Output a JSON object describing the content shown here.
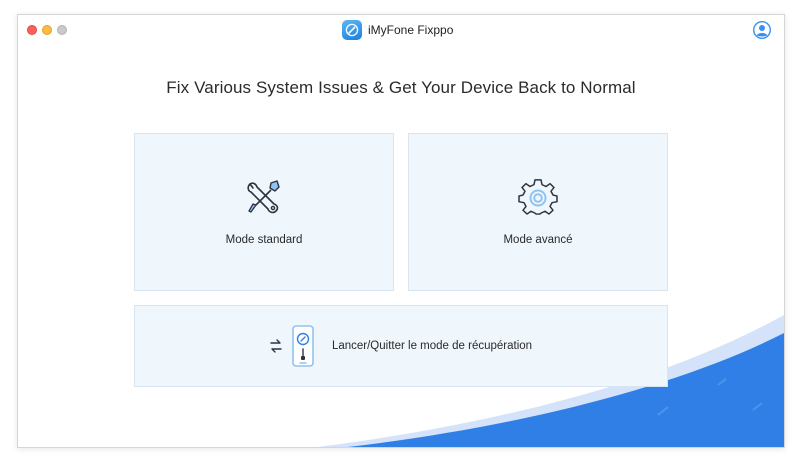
{
  "window": {
    "title": "iMyFone Fixppo"
  },
  "main": {
    "headline": "Fix Various System Issues & Get Your Device Back to Normal",
    "modes": [
      {
        "label": "Mode standard",
        "icon": "tools-icon"
      },
      {
        "label": "Mode avancé",
        "icon": "gear-icon"
      }
    ],
    "recovery": {
      "label": "Lancer/Quitter le mode de récupération",
      "icon": "phone-recovery-icon"
    }
  },
  "colors": {
    "accent": "#2f7fe6",
    "card_bg": "#eff6fc",
    "card_border": "#d8e4ef"
  }
}
